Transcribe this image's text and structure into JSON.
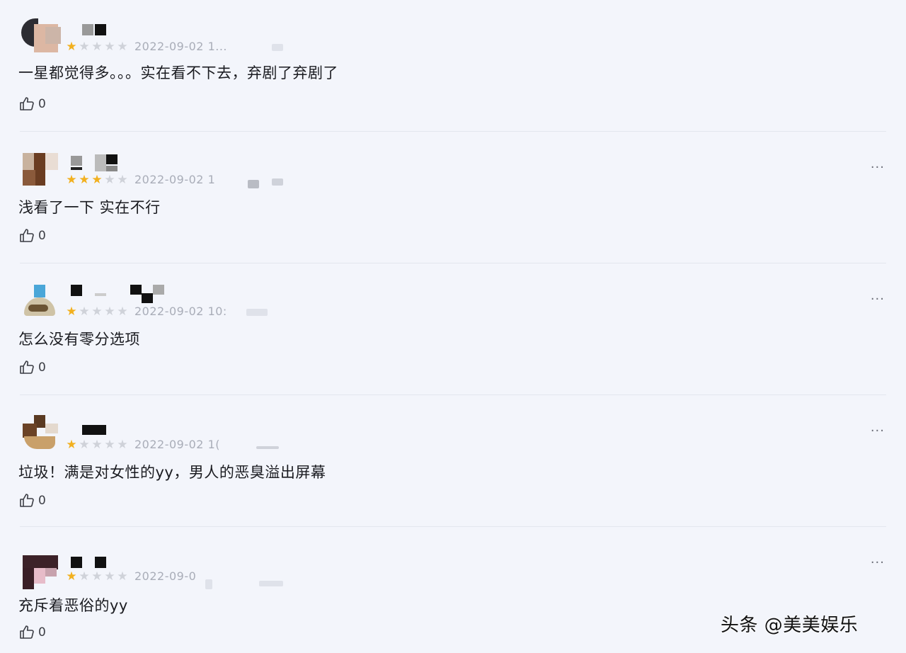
{
  "reviews": [
    {
      "rating": 1,
      "time": "2022-09-02 1...",
      "content": "一星都觉得多。。。实在看不下去，弃剧了弃剧了",
      "likes": "0",
      "more": ""
    },
    {
      "rating": 3,
      "time": "2022-09-02 1",
      "content": "浅看了一下 实在不行",
      "likes": "0",
      "more": "···"
    },
    {
      "rating": 1,
      "time": "2022-09-02 10:",
      "content": "怎么没有零分选项",
      "likes": "0",
      "more": "···"
    },
    {
      "rating": 1,
      "time": "2022-09-02 1(",
      "content": "垃圾！满是对女性的yy，男人的恶臭溢出屏幕",
      "likes": "0",
      "more": "···"
    },
    {
      "rating": 1,
      "time": "2022-09-0",
      "content": "充斥着恶俗的yy",
      "likes": "0",
      "more": "···"
    }
  ],
  "icons": {
    "star": "star-icon",
    "like": "thumbs-up-icon",
    "more": "more-options-icon"
  },
  "colors": {
    "background": "#f3f5fb",
    "star_on": "#f2b01e",
    "star_off": "#cfd2d9",
    "time": "#a9adb8"
  },
  "watermark": "头条 @美美娱乐"
}
